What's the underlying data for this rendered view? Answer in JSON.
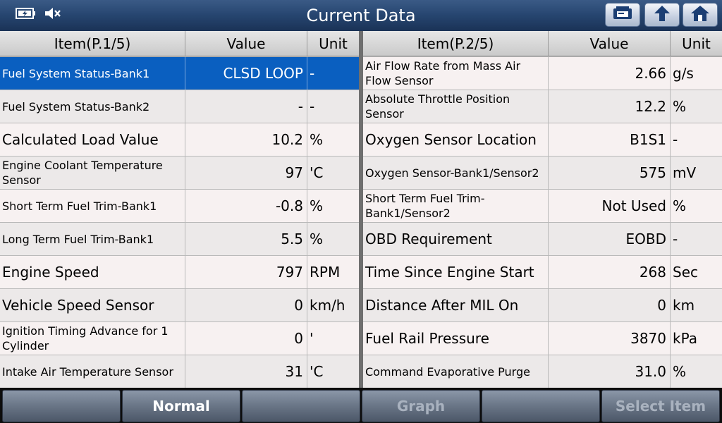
{
  "header": {
    "title": "Current Data",
    "icons": [
      "battery-icon",
      "speaker-muted-icon"
    ],
    "buttons": [
      "printer-icon",
      "back-arrow-icon",
      "home-icon"
    ]
  },
  "left_table": {
    "headers": {
      "item": "Item(P.1/5)",
      "value": "Value",
      "unit": "Unit"
    },
    "rows": [
      {
        "item": "Fuel System Status-Bank1",
        "value": "CLSD LOOP",
        "unit": "-"
      },
      {
        "item": "Fuel System Status-Bank2",
        "value": "-",
        "unit": "-"
      },
      {
        "item": "Calculated Load Value",
        "value": "10.2",
        "unit": "%"
      },
      {
        "item": "Engine Coolant Temperature Sensor",
        "value": "97",
        "unit": "'C"
      },
      {
        "item": "Short Term Fuel Trim-Bank1",
        "value": "-0.8",
        "unit": "%"
      },
      {
        "item": "Long Term Fuel Trim-Bank1",
        "value": "5.5",
        "unit": "%"
      },
      {
        "item": "Engine Speed",
        "value": "797",
        "unit": "RPM"
      },
      {
        "item": "Vehicle Speed Sensor",
        "value": "0",
        "unit": "km/h"
      },
      {
        "item": "Ignition Timing Advance for 1 Cylinder",
        "value": "0",
        "unit": "'"
      },
      {
        "item": "Intake Air Temperature Sensor",
        "value": "31",
        "unit": "'C"
      }
    ]
  },
  "right_table": {
    "headers": {
      "item": "Item(P.2/5)",
      "value": "Value",
      "unit": "Unit"
    },
    "rows": [
      {
        "item": "Air Flow Rate from Mass Air Flow Sensor",
        "value": "2.66",
        "unit": "g/s"
      },
      {
        "item": "Absolute Throttle Position Sensor",
        "value": "12.2",
        "unit": "%"
      },
      {
        "item": "Oxygen Sensor Location",
        "value": "B1S1",
        "unit": "-"
      },
      {
        "item": "Oxygen Sensor-Bank1/Sensor2",
        "value": "575",
        "unit": "mV"
      },
      {
        "item": "Short Term Fuel Trim-Bank1/Sensor2",
        "value": "Not Used",
        "unit": "%"
      },
      {
        "item": "OBD Requirement",
        "value": "EOBD",
        "unit": "-"
      },
      {
        "item": "Time Since Engine Start",
        "value": "268",
        "unit": "Sec"
      },
      {
        "item": "Distance After MIL On",
        "value": "0",
        "unit": "km"
      },
      {
        "item": "Fuel Rail Pressure",
        "value": "3870",
        "unit": "kPa"
      },
      {
        "item": "Command Evaporative Purge",
        "value": "31.0",
        "unit": "%"
      }
    ]
  },
  "bottom_bar": {
    "normal_label": "Normal",
    "graph_label": "Graph",
    "select_item_label": "Select Item"
  },
  "colors": {
    "selected_row": "#0a5fc0",
    "title_bar": "#26456f"
  }
}
